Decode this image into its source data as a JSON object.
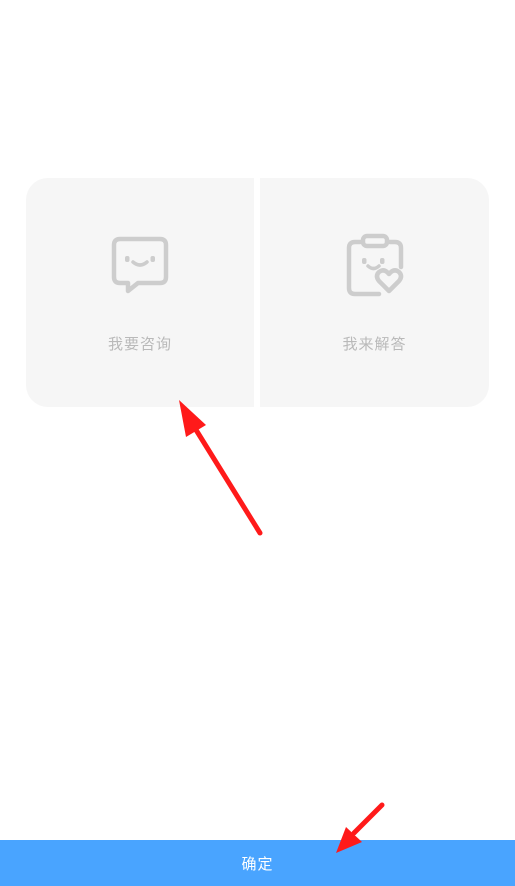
{
  "choices": {
    "consult": {
      "label": "我要咨询",
      "icon": "chat-smile-icon"
    },
    "answer": {
      "label": "我来解答",
      "icon": "clipboard-heart-icon"
    }
  },
  "footer": {
    "confirm_label": "确定"
  },
  "colors": {
    "card_background": "#f6f6f6",
    "icon_gray": "#cdcdcd",
    "label_gray": "#b9b9b9",
    "confirm_blue": "#49a4ff",
    "annotation_red": "#ff1a1a"
  }
}
